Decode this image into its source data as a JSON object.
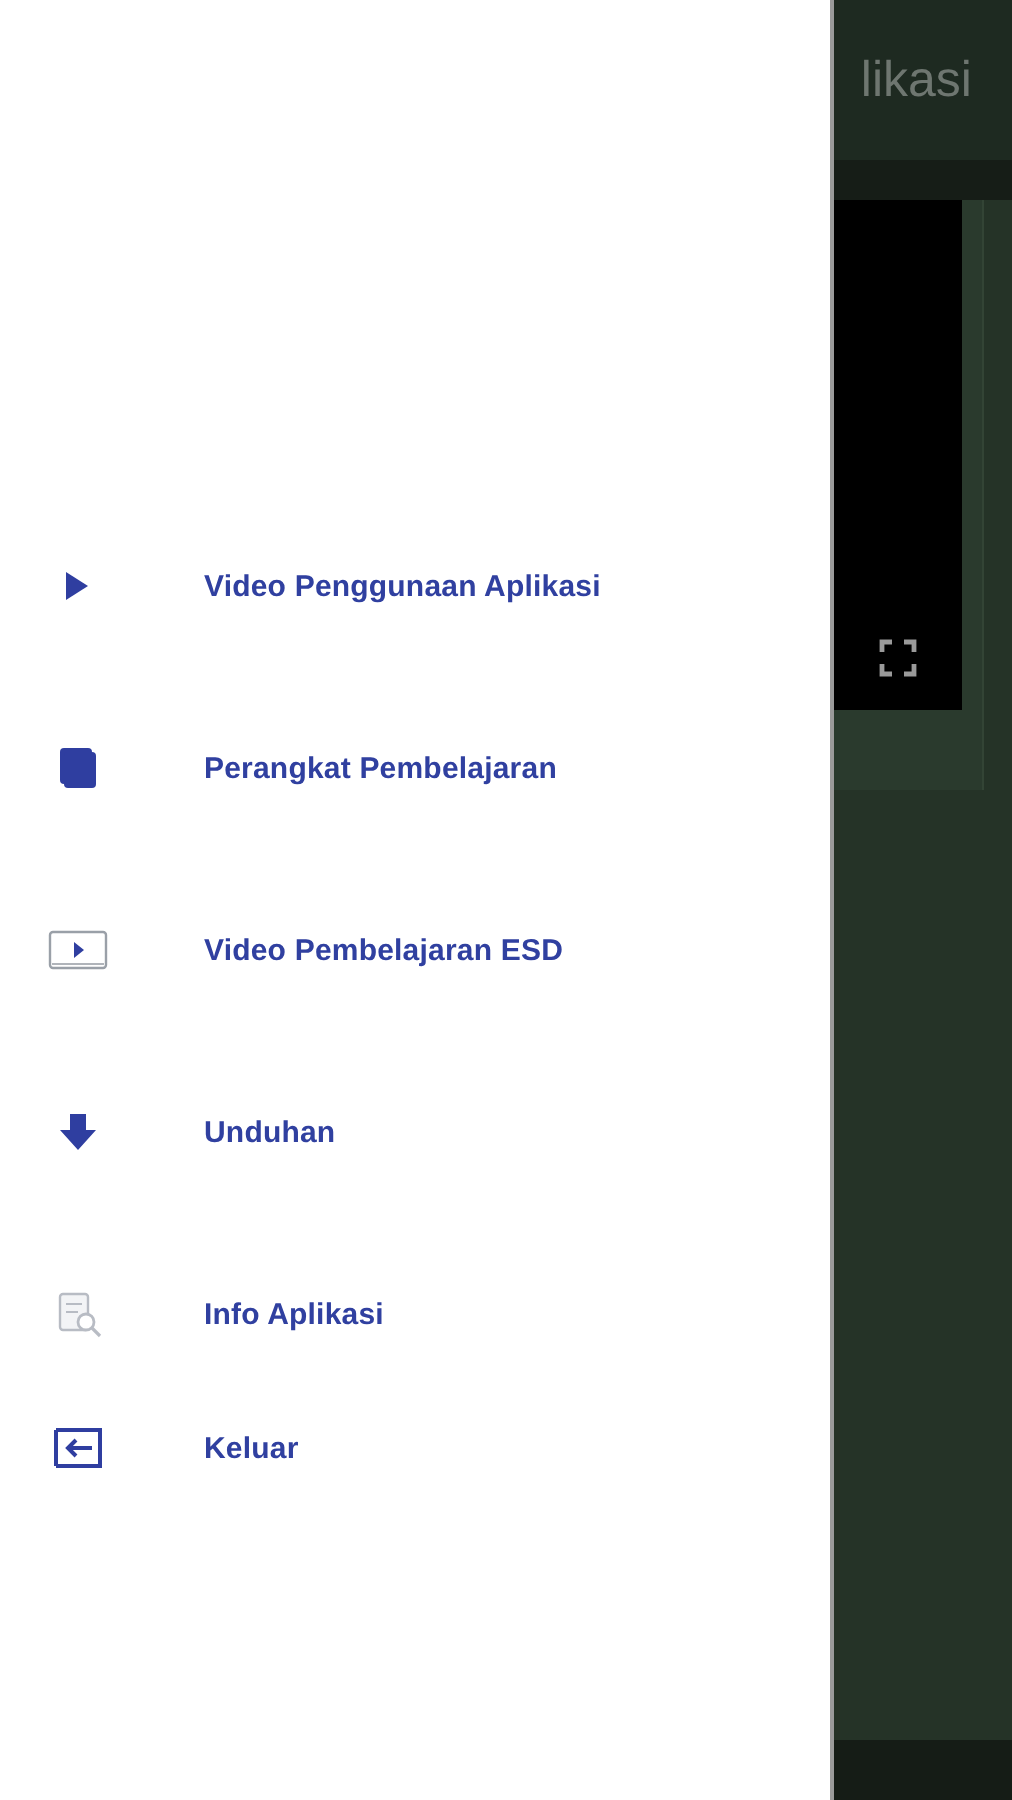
{
  "app_bar": {
    "title": "likasi"
  },
  "drawer": {
    "items": [
      {
        "label": "Video Penggunaan Aplikasi"
      },
      {
        "label": "Perangkat Pembelajaran"
      },
      {
        "label": "Video Pembelajaran ESD"
      },
      {
        "label": "Unduhan"
      },
      {
        "label": "Info Aplikasi"
      },
      {
        "label": "Keluar"
      }
    ]
  }
}
